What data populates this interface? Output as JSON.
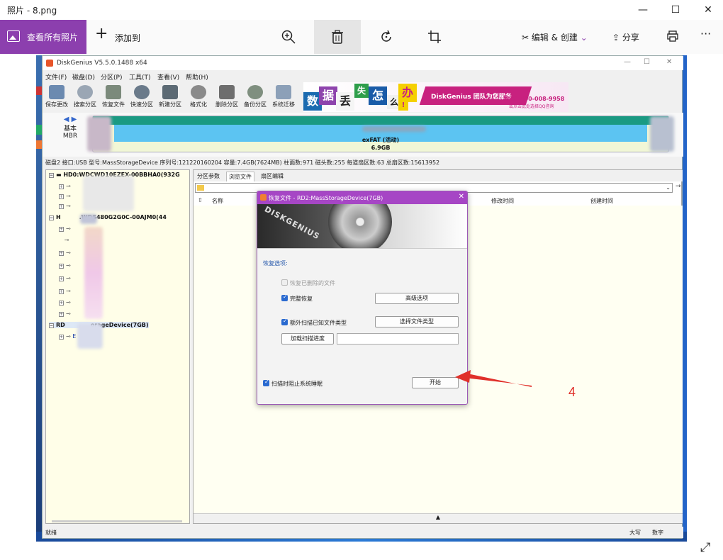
{
  "photos": {
    "window_title": "照片 - 8.png",
    "view_all_label": "查看所有照片",
    "add_to_label": "添加到",
    "edit_create_label": "编辑 & 创建",
    "share_label": "分享"
  },
  "app": {
    "title": "DiskGenius V5.5.0.1488 x64",
    "menu": [
      "文件(F)",
      "磁盘(D)",
      "分区(P)",
      "工具(T)",
      "查看(V)",
      "帮助(H)"
    ],
    "tools": [
      "保存更改",
      "搜索分区",
      "恢复文件",
      "快速分区",
      "新建分区",
      "格式化",
      "删除分区",
      "备份分区",
      "系统迁移"
    ],
    "banner": {
      "chars": [
        "数",
        "据",
        "丢",
        "失",
        "怎",
        "么",
        "办",
        "!"
      ],
      "slogan": "DiskGenius 团队为您服务",
      "hotline": "致电：400-008-9958",
      "qq": "或点击此处选择QQ咨询"
    },
    "diskmap": {
      "type_label": "基本",
      "scheme_label": "MBR",
      "partition_fs": "exFAT (活动)",
      "partition_size": "6.9GB"
    },
    "disk_info": "磁盘2 接口:USB  型号:MassStorageDevice  序列号:121220160204  容量:7.4GB(7624MB)  柱面数:971  磁头数:255  每道扇区数:63  总扇区数:15613952",
    "tree": {
      "hd0": "HD0:WDCWD10EZEX-00BBHA0(932G",
      "hd1": "H",
      "hd1_rest": ".WDS480G2G0C-00AJM0(44",
      "rd2a": "RD",
      "rd2b": "orageDevice(7GB)",
      "rd2_child": "E"
    },
    "tabs": [
      "分区参数",
      "浏览文件",
      "扇区编辑"
    ],
    "columns": [
      "名称",
      "修改时间",
      "创建时间"
    ],
    "status": {
      "left": "就绪",
      "caps": "大写",
      "num": "数字"
    }
  },
  "dialog": {
    "title": "恢复文件 - RD2:MassStorageDevice(7GB)",
    "brand": "DISKGENIUS",
    "section": "恢复选项:",
    "opt_deleted": "恢复已删除的文件",
    "opt_full": "完整恢复",
    "btn_advanced": "高级选项",
    "opt_extra": "额外扫描已知文件类型",
    "btn_filetypes": "选择文件类型",
    "btn_load": "加载扫描进度",
    "opt_prevent_sleep": "扫描时阻止系统睡眠",
    "btn_start": "开始"
  },
  "annotation": {
    "step": "4",
    "color": "#e0302a"
  }
}
